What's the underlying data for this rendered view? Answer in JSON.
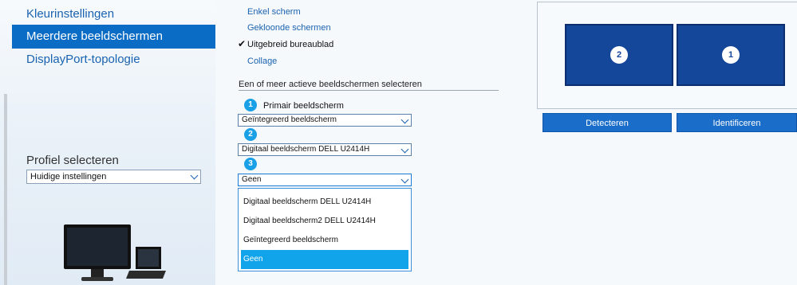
{
  "sidebar": {
    "items": [
      {
        "label": "Kleurinstellingen",
        "active": false
      },
      {
        "label": "Meerdere beeldschermen",
        "active": true
      },
      {
        "label": "DisplayPort-topologie",
        "active": false
      }
    ],
    "profile_label": "Profiel selecteren",
    "profile_value": "Huidige instellingen"
  },
  "modes": {
    "single": "Enkel scherm",
    "clone": "Gekloonde schermen",
    "extended": "Uitgebreid bureaublad",
    "collage": "Collage",
    "checkmark": "✔"
  },
  "displays": {
    "section_title": "Een of meer actieve beeldschermen selecteren",
    "primary_label": "Primair beeldscherm",
    "slots": [
      {
        "number": "1",
        "value": "Geïntegreerd beeldscherm"
      },
      {
        "number": "2",
        "value": "Digitaal beeldscherm DELL U2414H"
      },
      {
        "number": "3",
        "value": "Geen"
      }
    ],
    "options": [
      "Digitaal beeldscherm DELL U2414H",
      "Digitaal beeldscherm2 DELL U2414H",
      "Geïntegreerd beeldscherm",
      "Geen"
    ],
    "selected_option": "Geen"
  },
  "arrangement": {
    "monitors": [
      {
        "number": "2"
      },
      {
        "number": "1"
      }
    ],
    "detect_label": "Detecteren",
    "identify_label": "Identificeren"
  },
  "colors": {
    "accent": "#0b6cc6",
    "monitor_fill": "#14469a",
    "badge": "#1aa0e6",
    "selected_option": "#11a4eb"
  }
}
